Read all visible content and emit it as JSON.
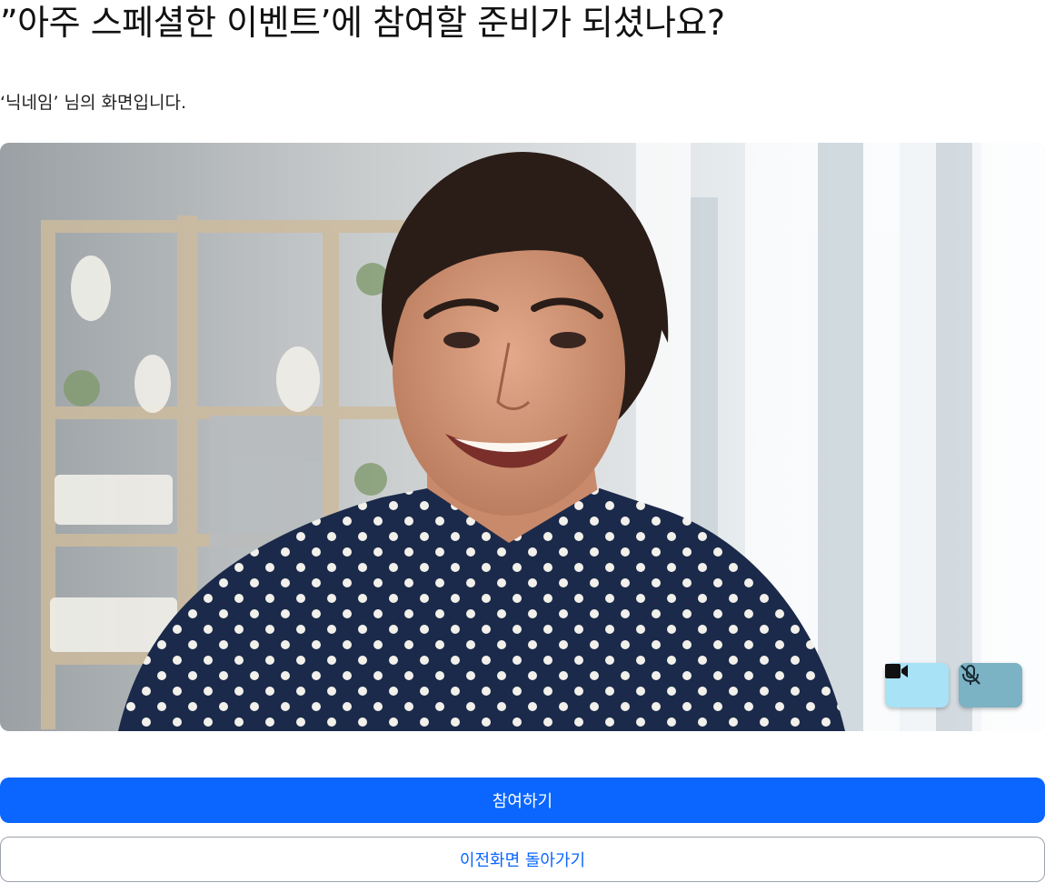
{
  "page": {
    "title": "”아주 스페셜한 이벤트’에 참여할 준비가 되셨나요?",
    "subtitle": "‘닉네임’ 님의 화면입니다."
  },
  "video_preview": {
    "image": "smiling-woman-webcam-preview",
    "controls": {
      "camera": {
        "icon": "video-camera-icon",
        "state": "on",
        "color": "#a8e2f6"
      },
      "microphone": {
        "icon": "microphone-off-icon",
        "state": "muted",
        "color": "#7bb2c4"
      }
    }
  },
  "actions": {
    "join_label": "참여하기",
    "back_label": "이전화면 돌아가기"
  },
  "colors": {
    "primary": "#0a66ff",
    "text": "#111111"
  }
}
